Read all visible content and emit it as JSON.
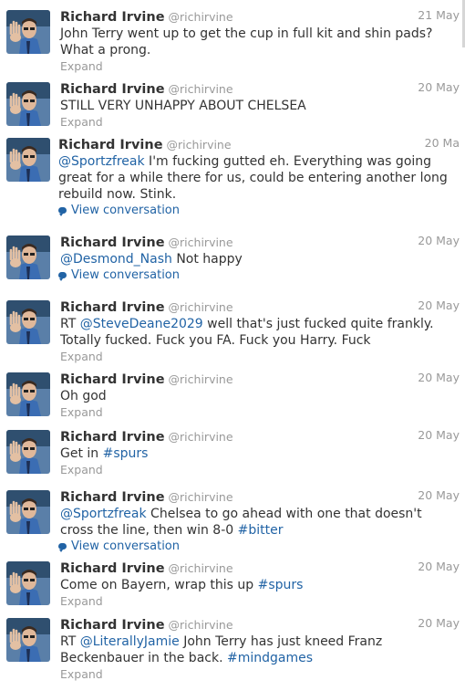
{
  "user": {
    "name": "Richard Irvine",
    "handle": "@richirvine"
  },
  "tweets": [
    {
      "date": "21 May",
      "lines": [
        [
          {
            "t": "John Terry went up to get the cup in full kit and shin pads?"
          }
        ],
        [
          {
            "t": "What a prong."
          }
        ]
      ],
      "action": "Expand"
    },
    {
      "date": "20 May",
      "lines": [
        [
          {
            "t": "STILL VERY UNHAPPY ABOUT CHELSEA"
          }
        ]
      ],
      "action": "Expand"
    },
    {
      "date": "20 Ma",
      "lines": [
        [
          {
            "t": "@Sportzfreak",
            "link": true
          },
          {
            "t": " I'm fucking gutted eh. Everything was going"
          }
        ],
        [
          {
            "t": "great for a while there for us, could be entering another long"
          }
        ],
        [
          {
            "t": "rebuild now. Stink."
          }
        ]
      ],
      "action": "View conversation"
    },
    {
      "date": "20 May",
      "lines": [
        [
          {
            "t": "@Desmond_Nash",
            "link": true
          },
          {
            "t": " Not happy"
          }
        ]
      ],
      "action": "View conversation"
    },
    {
      "date": "20 May",
      "lines": [
        [
          {
            "t": "RT "
          },
          {
            "t": "@SteveDeane2029",
            "link": true
          },
          {
            "t": " well that's just fucked quite frankly."
          }
        ],
        [
          {
            "t": "Totally fucked. Fuck you FA. Fuck you Harry. Fuck"
          }
        ]
      ],
      "action": "Expand"
    },
    {
      "date": "20 May",
      "lines": [
        [
          {
            "t": "Oh god"
          }
        ]
      ],
      "action": "Expand"
    },
    {
      "date": "20 May",
      "lines": [
        [
          {
            "t": "Get in "
          },
          {
            "t": "#spurs",
            "link": true
          }
        ]
      ],
      "action": "Expand"
    },
    {
      "date": "20 May",
      "lines": [
        [
          {
            "t": "@Sportzfreak",
            "link": true
          },
          {
            "t": " Chelsea to go ahead with one that doesn't"
          }
        ],
        [
          {
            "t": "cross the line, then win 8-0 "
          },
          {
            "t": "#bitter",
            "link": true
          }
        ]
      ],
      "action": "View conversation"
    },
    {
      "date": "20 May",
      "lines": [
        [
          {
            "t": "Come on Bayern, wrap this up "
          },
          {
            "t": "#spurs",
            "link": true
          }
        ]
      ],
      "action": "Expand"
    },
    {
      "date": "20 May",
      "lines": [
        [
          {
            "t": "RT "
          },
          {
            "t": "@LiterallyJamie",
            "link": true
          },
          {
            "t": " John Terry has just kneed Franz"
          }
        ],
        [
          {
            "t": "Beckenbauer in the back. "
          },
          {
            "t": "#mindgames",
            "link": true
          }
        ]
      ],
      "action": "Expand"
    }
  ]
}
